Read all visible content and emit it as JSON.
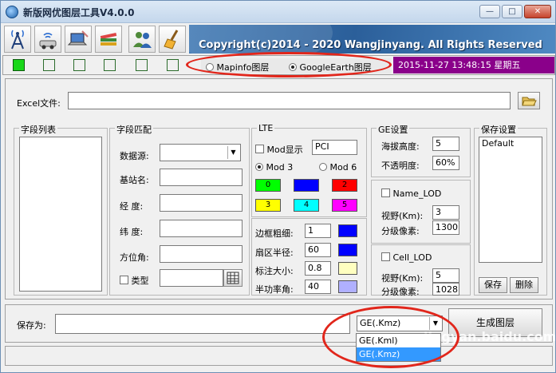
{
  "window": {
    "title": "新版网优图层工具V4.0.0",
    "controls": {
      "minimize": "—",
      "maximize": "□",
      "close": "✕"
    }
  },
  "toolbar": {
    "buttons": [
      {
        "icon": "antenna-tower-icon"
      },
      {
        "icon": "wifi-car-icon"
      },
      {
        "icon": "laptop-network-icon"
      },
      {
        "icon": "books-icon"
      },
      {
        "icon": "users-icon"
      },
      {
        "icon": "broom-icon"
      }
    ],
    "banner": "Copyright(c)2014 - 2020 Wangjinyang. All Rights Reserved"
  },
  "status": {
    "leds": [
      true,
      false,
      false,
      false,
      false,
      false
    ],
    "layer_options": [
      {
        "label": "Mapinfo图层",
        "selected": false
      },
      {
        "label": "GoogleEarth图层",
        "selected": true
      }
    ],
    "datetime": "2015-11-27 13:48:15  星期五"
  },
  "excel": {
    "label": "Excel文件:",
    "value": ""
  },
  "field_list": {
    "title": "字段列表"
  },
  "field_match": {
    "title": "字段匹配",
    "data_source_label": "数据源:",
    "station_label": "基站名:",
    "longitude_label": "经  度:",
    "latitude_label": "纬  度:",
    "azimuth_label": "方位角:",
    "type_label": "类型"
  },
  "lte": {
    "title": "LTE",
    "mod_display_label": "Mod显示",
    "mod_display_value": "PCI",
    "mod3_label": "Mod 3",
    "mod6_label": "Mod 6",
    "swatches": [
      {
        "label": "0",
        "color": "#00ff00"
      },
      {
        "label": "",
        "color": "#0000ff"
      },
      {
        "label": "2",
        "color": "#ff0000"
      },
      {
        "label": "3",
        "color": "#ffff00"
      },
      {
        "label": "4",
        "color": "#00ffff"
      },
      {
        "label": "5",
        "color": "#ff00ff"
      }
    ],
    "border_width_label": "边框粗细:",
    "border_width_value": "1",
    "border_width_color": "#0000ff",
    "sector_radius_label": "扇区半径:",
    "sector_radius_value": "60",
    "sector_radius_color": "#0000ff",
    "label_size_label": "标注大小:",
    "label_size_value": "0.8",
    "label_size_color": "#ffffc0",
    "half_power_label": "半功率角:",
    "half_power_value": "40",
    "half_power_color": "#b0b0ff"
  },
  "ge": {
    "title": "GE设置",
    "altitude_label": "海拔高度:",
    "altitude_value": "5",
    "opacity_label": "不透明度:",
    "opacity_value": "60%",
    "name_lod_label": "Name_LOD",
    "name_view_label": "视野(Km):",
    "name_view_value": "3",
    "name_pixel_label": "分级像素:",
    "name_pixel_value": "1300",
    "cell_lod_label": "Cell_LOD",
    "cell_view_label": "视野(Km):",
    "cell_view_value": "5",
    "cell_pixel_label": "分级像素:",
    "cell_pixel_value": "1028"
  },
  "save_settings": {
    "title": "保存设置",
    "items": [
      "Default"
    ],
    "save_label": "保存",
    "delete_label": "删除"
  },
  "save_as": {
    "label": "保存为:",
    "value": "",
    "format_selected": "GE(.Kmz)",
    "format_options": [
      "GE(.Kml)",
      "GE(.Kmz)"
    ],
    "generate_label": "生成图层"
  },
  "watermark": "jingyan.baidu.com  百度经验"
}
